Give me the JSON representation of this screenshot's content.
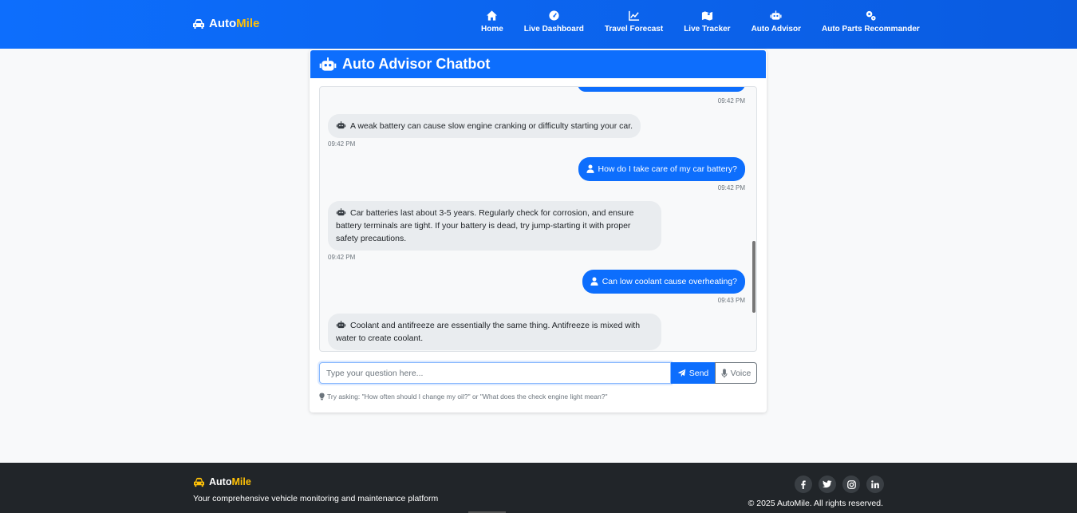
{
  "brand": {
    "name_part1": "Auto",
    "name_part2": "Mile",
    "icon": "car-icon"
  },
  "nav": [
    {
      "label": "Home",
      "icon": "home-icon"
    },
    {
      "label": "Live Dashboard",
      "icon": "gauge-icon"
    },
    {
      "label": "Travel Forecast",
      "icon": "chart-line-icon"
    },
    {
      "label": "Live Tracker",
      "icon": "map-icon"
    },
    {
      "label": "Auto Advisor",
      "icon": "robot-icon"
    },
    {
      "label": "Auto Parts Recommander",
      "icon": "gears-icon"
    }
  ],
  "chat": {
    "title": "Auto Advisor Chatbot",
    "messages": [
      {
        "role": "user",
        "text": "",
        "time": "09:42 PM"
      },
      {
        "role": "bot",
        "text": "A weak battery can cause slow engine cranking or difficulty starting your car.",
        "time": "09:42 PM"
      },
      {
        "role": "user",
        "text": "How do I take care of my car battery?",
        "time": "09:42 PM"
      },
      {
        "role": "bot",
        "text": "Car batteries last about 3-5 years. Regularly check for corrosion, and ensure battery terminals are tight. If your battery is dead, try jump-starting it with proper safety precautions.",
        "time": "09:42 PM"
      },
      {
        "role": "user",
        "text": "Can low coolant cause overheating?",
        "time": "09:43 PM"
      },
      {
        "role": "bot",
        "text": "Coolant and antifreeze are essentially the same thing. Antifreeze is mixed with water to create coolant.",
        "time": ""
      }
    ],
    "input_placeholder": "Type your question here...",
    "input_value": "",
    "send_label": "Send",
    "voice_label": "Voice",
    "hint": "Try asking: \"How often should I change my oil?\" or \"What does the check engine light mean?\""
  },
  "footer": {
    "brand_part1": "Auto",
    "brand_part2": "Mile",
    "tagline": "Your comprehensive vehicle monitoring and maintenance platform",
    "copyright": "© 2025 AutoMile. All rights reserved.",
    "socials": [
      "facebook-icon",
      "twitter-icon",
      "instagram-icon",
      "linkedin-icon"
    ]
  },
  "colors": {
    "primary": "#0d6efd",
    "accent": "#ffc107",
    "footer_bg": "#212529",
    "bot_bubble": "#e9ecef"
  }
}
